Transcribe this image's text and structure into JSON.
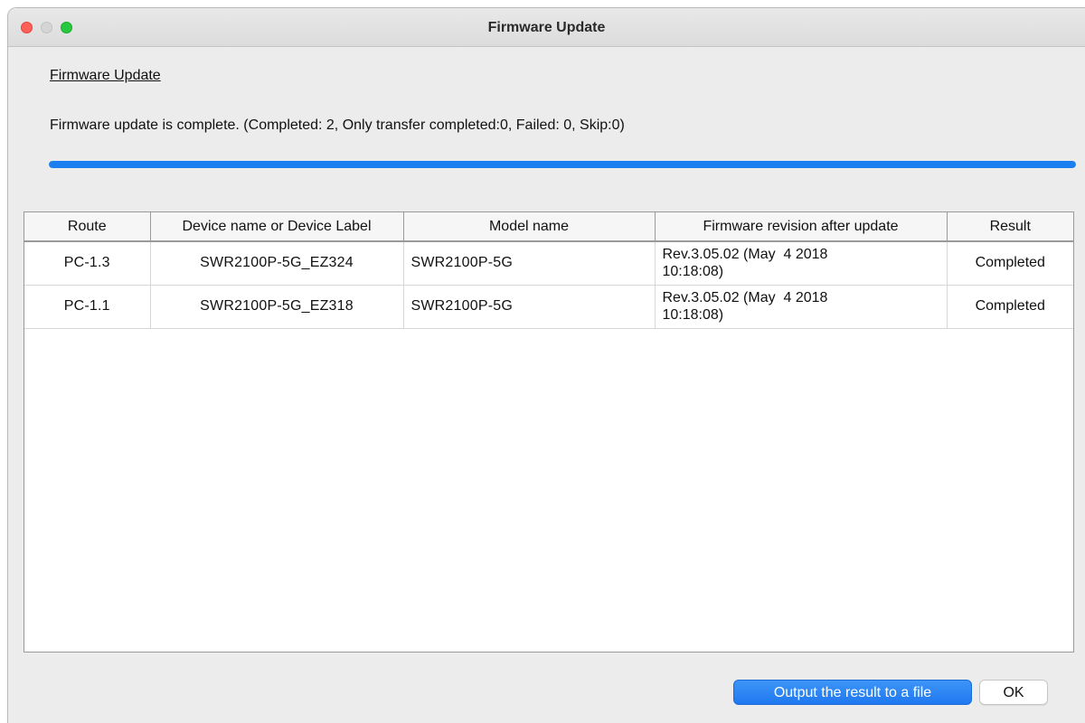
{
  "window": {
    "title": "Firmware Update"
  },
  "section_title": "Firmware Update",
  "status_message": "Firmware update is complete. (Completed: 2, Only transfer completed:0, Failed: 0, Skip:0)",
  "progress": {
    "percent": 100,
    "color": "#1a7ff0"
  },
  "table": {
    "headers": {
      "route": "Route",
      "device": "Device name or Device Label",
      "model": "Model name",
      "firmware": "Firmware revision after update",
      "result": "Result"
    },
    "rows": [
      {
        "route": "PC-1.3",
        "device": "SWR2100P-5G_EZ324",
        "model": "SWR2100P-5G",
        "firmware_line1": "Rev.3.05.02 (May  4 2018",
        "firmware_line2": "10:18:08)",
        "result": "Completed"
      },
      {
        "route": "PC-1.1",
        "device": "SWR2100P-5G_EZ318",
        "model": "SWR2100P-5G",
        "firmware_line1": "Rev.3.05.02 (May  4 2018",
        "firmware_line2": "10:18:08)",
        "result": "Completed"
      }
    ]
  },
  "buttons": {
    "output_label": "Output the result to a file",
    "ok_label": "OK"
  },
  "colors": {
    "accent": "#1f78f0",
    "close": "#fe5f57",
    "minimize_inactive": "#d5d5d5",
    "maximize": "#28c840"
  }
}
